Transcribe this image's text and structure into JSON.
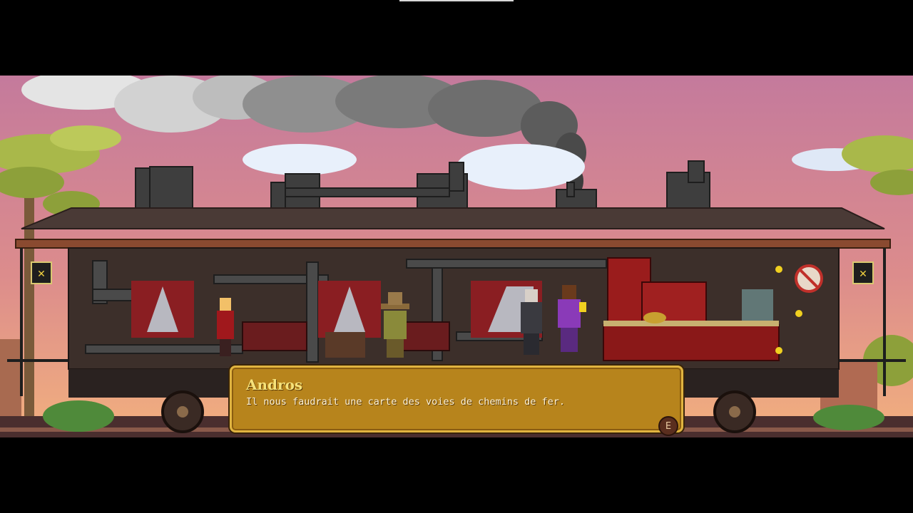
{
  "dialog": {
    "speaker": "Andros",
    "text": "Il nous faudrait une carte des voies de chemins de fer.",
    "continue_key": "E"
  },
  "palette": {
    "sky_top": "#c47a9c",
    "sky_bottom": "#f2b07e",
    "train_body": "#3c2f2a",
    "dialog_bg": "#b7841c",
    "dialog_border": "#e0b440",
    "name_color": "#f6e27a"
  },
  "icons": [
    "lantern-icon",
    "no-smoking-icon",
    "continue-key-icon"
  ]
}
